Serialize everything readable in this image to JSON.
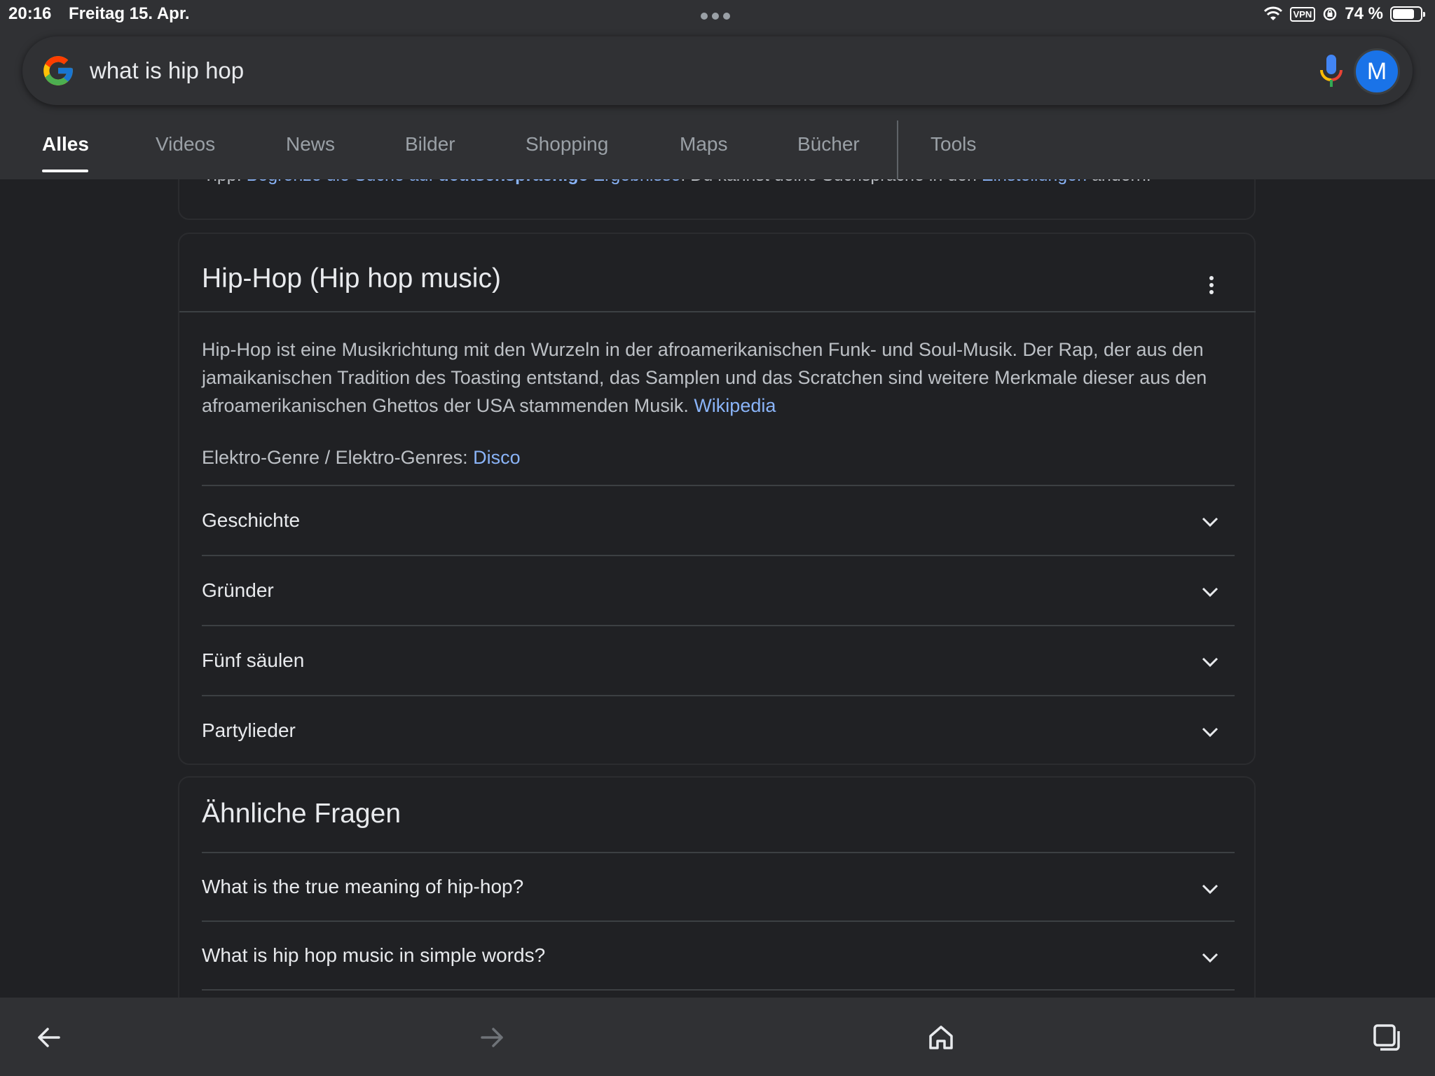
{
  "status_bar": {
    "time": "20:16",
    "date": "Freitag 15. Apr.",
    "vpn": "VPN",
    "battery": "74 %"
  },
  "search": {
    "query": "what is hip hop",
    "avatar_letter": "M"
  },
  "tabs": [
    {
      "label": "Alles"
    },
    {
      "label": "Videos"
    },
    {
      "label": "News"
    },
    {
      "label": "Bilder"
    },
    {
      "label": "Shopping"
    },
    {
      "label": "Maps"
    },
    {
      "label": "Bücher"
    },
    {
      "label": "Tools"
    }
  ],
  "tip": {
    "prefix": "Tipp: ",
    "link_part1": "Begrenze die Suche auf ",
    "link_bold": "deutschsprachige",
    "link_part2": " Ergebnisse",
    "middle": ". Du kannst deine Suchsprache in den ",
    "settings_link": "Einstellungen",
    "suffix": " ändern."
  },
  "knowledge_panel": {
    "title": "Hip-Hop (Hip hop music)",
    "description": "Hip-Hop ist eine Musikrichtung mit den Wurzeln in der afroamerikanischen Funk- und Soul-Musik. Der Rap, der aus den jamaikanischen Tradition des Toasting entstand, das Samplen und das Scratchen sind weitere Merkmale dieser aus den afroamerikanischen Ghettos der USA stammenden Musik. ",
    "source_link": "Wikipedia",
    "genre_label": "Elektro-Genre / Elektro-Genres: ",
    "genre_link": "Disco",
    "sections": [
      {
        "label": "Geschichte"
      },
      {
        "label": "Gründer"
      },
      {
        "label": "Fünf säulen"
      },
      {
        "label": "Partylieder"
      }
    ]
  },
  "related_questions": {
    "title": "Ähnliche Fragen",
    "items": [
      {
        "label": "What is the true meaning of hip-hop?"
      },
      {
        "label": "What is hip hop music in simple words?"
      }
    ]
  },
  "colors": {
    "background": "#202124",
    "surface": "#303134",
    "link": "#8ab4f8",
    "accent": "#1a73e8"
  }
}
